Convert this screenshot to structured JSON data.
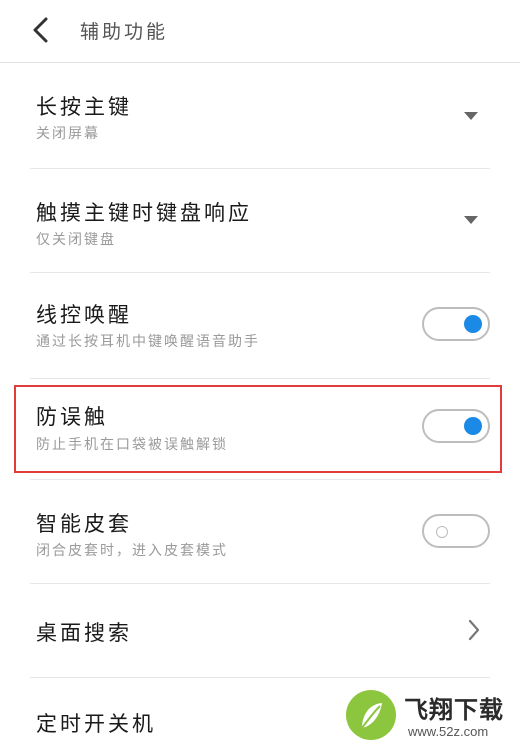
{
  "header": {
    "title": "辅助功能"
  },
  "items": [
    {
      "title": "长按主键",
      "subtitle": "关闭屏幕",
      "control": "dropdown"
    },
    {
      "title": "触摸主键时键盘响应",
      "subtitle": "仅关闭键盘",
      "control": "dropdown"
    },
    {
      "title": "线控唤醒",
      "subtitle": "通过长按耳机中键唤醒语音助手",
      "control": "toggle",
      "state": "on"
    },
    {
      "title": "防误触",
      "subtitle": "防止手机在口袋被误触解锁",
      "control": "toggle",
      "state": "on",
      "highlighted": true
    },
    {
      "title": "智能皮套",
      "subtitle": "闭合皮套时，进入皮套模式",
      "control": "toggle",
      "state": "off"
    },
    {
      "title": "桌面搜索",
      "control": "chevron"
    },
    {
      "title": "定时开关机"
    }
  ],
  "watermark": {
    "brand": "飞翔下载",
    "url": "www.52z.com"
  },
  "colors": {
    "toggle_on": "#1a8ae6",
    "highlight_border": "#e23b3b"
  }
}
